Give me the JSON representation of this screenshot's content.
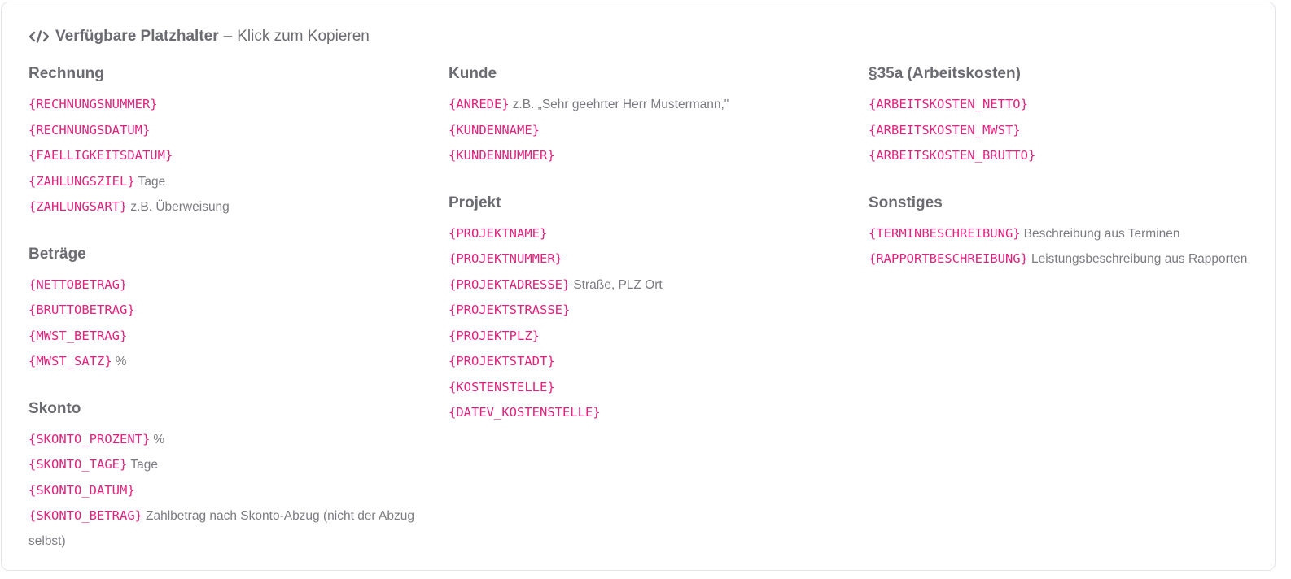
{
  "header": {
    "icon": "code-icon",
    "title": "Verfügbare Platzhalter",
    "dash": "–",
    "subtitle": "Klick zum Kopieren"
  },
  "colors": {
    "code": "#e2227d",
    "heading": "#6b6b72",
    "text": "#7b7b82",
    "border": "#e4e4ec"
  },
  "columns": [
    {
      "sections": [
        {
          "title": "Rechnung",
          "items": [
            {
              "code": "{RECHNUNGSNUMMER}",
              "desc": ""
            },
            {
              "code": "{RECHNUNGSDATUM}",
              "desc": ""
            },
            {
              "code": "{FAELLIGKEITSDATUM}",
              "desc": ""
            },
            {
              "code": "{ZAHLUNGSZIEL}",
              "desc": "Tage"
            },
            {
              "code": "{ZAHLUNGSART}",
              "desc": "z.B. Überweisung"
            }
          ]
        },
        {
          "title": "Beträge",
          "items": [
            {
              "code": "{NETTOBETRAG}",
              "desc": ""
            },
            {
              "code": "{BRUTTOBETRAG}",
              "desc": ""
            },
            {
              "code": "{MWST_BETRAG}",
              "desc": ""
            },
            {
              "code": "{MWST_SATZ}",
              "desc": "%"
            }
          ]
        },
        {
          "title": "Skonto",
          "items": [
            {
              "code": "{SKONTO_PROZENT}",
              "desc": "%"
            },
            {
              "code": "{SKONTO_TAGE}",
              "desc": "Tage"
            },
            {
              "code": "{SKONTO_DATUM}",
              "desc": ""
            },
            {
              "code": "{SKONTO_BETRAG}",
              "desc": "Zahlbetrag nach Skonto-Abzug (nicht der Abzug selbst)"
            }
          ]
        }
      ]
    },
    {
      "sections": [
        {
          "title": "Kunde",
          "items": [
            {
              "code": "{ANREDE}",
              "desc": "z.B. „Sehr geehrter Herr Mustermann,\""
            },
            {
              "code": "{KUNDENNAME}",
              "desc": ""
            },
            {
              "code": "{KUNDENNUMMER}",
              "desc": ""
            }
          ]
        },
        {
          "title": "Projekt",
          "items": [
            {
              "code": "{PROJEKTNAME}",
              "desc": ""
            },
            {
              "code": "{PROJEKTNUMMER}",
              "desc": ""
            },
            {
              "code": "{PROJEKTADRESSE}",
              "desc": "Straße, PLZ Ort"
            },
            {
              "code": "{PROJEKTSTRASSE}",
              "desc": ""
            },
            {
              "code": "{PROJEKTPLZ}",
              "desc": ""
            },
            {
              "code": "{PROJEKTSTADT}",
              "desc": ""
            },
            {
              "code": "{KOSTENSTELLE}",
              "desc": ""
            },
            {
              "code": "{DATEV_KOSTENSTELLE}",
              "desc": ""
            }
          ]
        }
      ]
    },
    {
      "sections": [
        {
          "title": "§35a (Arbeitskosten)",
          "items": [
            {
              "code": "{ARBEITSKOSTEN_NETTO}",
              "desc": ""
            },
            {
              "code": "{ARBEITSKOSTEN_MWST}",
              "desc": ""
            },
            {
              "code": "{ARBEITSKOSTEN_BRUTTO}",
              "desc": ""
            }
          ]
        },
        {
          "title": "Sonstiges",
          "items": [
            {
              "code": "{TERMINBESCHREIBUNG}",
              "desc": "Beschreibung aus Terminen"
            },
            {
              "code": "{RAPPORTBESCHREIBUNG}",
              "desc": "Leistungsbeschreibung aus Rapporten"
            }
          ]
        }
      ]
    }
  ]
}
